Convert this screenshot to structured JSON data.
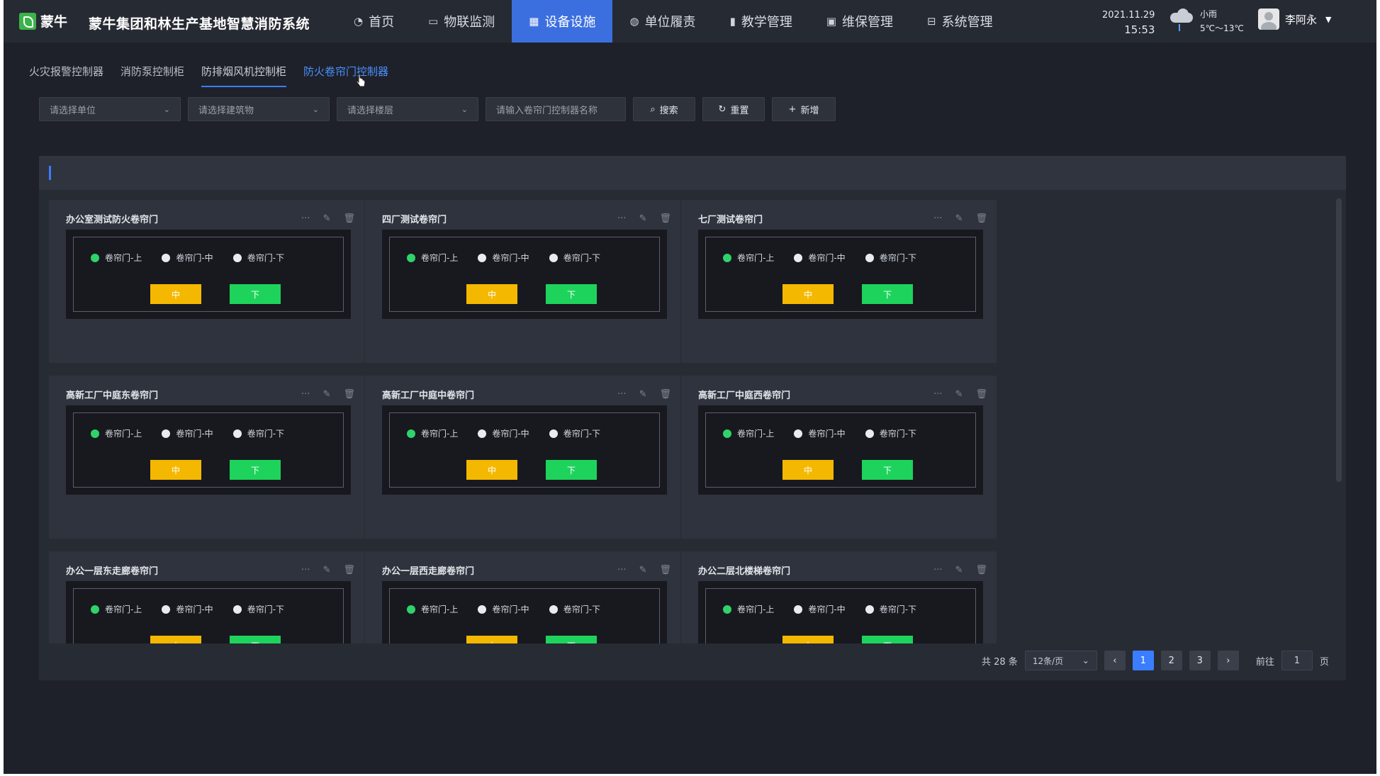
{
  "brand": {
    "logo_text": "蒙牛",
    "system_title": "蒙牛集团和林生产基地智慧消防系统"
  },
  "nav": [
    {
      "label": "首页",
      "icon": "dashboard-icon",
      "glyph": "◔"
    },
    {
      "label": "物联监测",
      "icon": "monitor-icon",
      "glyph": "▭"
    },
    {
      "label": "设备设施",
      "icon": "equipment-icon",
      "glyph": "▦"
    },
    {
      "label": "单位履责",
      "icon": "globe-icon",
      "glyph": "◍"
    },
    {
      "label": "教学管理",
      "icon": "book-icon",
      "glyph": "▮"
    },
    {
      "label": "维保管理",
      "icon": "maintenance-icon",
      "glyph": "▣"
    },
    {
      "label": "系统管理",
      "icon": "briefcase-icon",
      "glyph": "⊟"
    }
  ],
  "nav_active_index": 2,
  "header": {
    "date": "2021.11.29",
    "time": "15:53",
    "weather": "小雨",
    "temperature": "5℃～13℃",
    "user_name": "李阿永"
  },
  "subtabs": [
    "火灾报警控制器",
    "消防泵控制柜",
    "防排烟风机控制柜",
    "防火卷帘门控制器"
  ],
  "subtab_active_index": 3,
  "filters": {
    "unit_placeholder": "请选择单位",
    "building_placeholder": "请选择建筑物",
    "floor_placeholder": "请选择楼层",
    "name_placeholder": "请输入卷帘门控制器名称",
    "search_label": "搜索",
    "reset_label": "重置",
    "add_label": "新增"
  },
  "card_labels": {
    "radio_up": "卷帘门-上",
    "radio_mid": "卷帘门-中",
    "radio_down": "卷帘门-下",
    "btn_mid": "中",
    "btn_down": "下"
  },
  "cards": [
    {
      "title": "办公室测试防火卷帘门"
    },
    {
      "title": "四厂测试卷帘门"
    },
    {
      "title": "七厂测试卷帘门"
    },
    {
      "title": "高新工厂中庭东卷帘门"
    },
    {
      "title": "高新工厂中庭中卷帘门"
    },
    {
      "title": "高新工厂中庭西卷帘门"
    },
    {
      "title": "办公一层东走廊卷帘门"
    },
    {
      "title": "办公一层西走廊卷帘门"
    },
    {
      "title": "办公二层北楼梯卷帘门"
    }
  ],
  "pagination": {
    "total_text": "共 28 条",
    "page_size": "12条/页",
    "pages": [
      "1",
      "2",
      "3"
    ],
    "current_page_index": 0,
    "goto_label": "前往",
    "goto_value": "1",
    "page_unit": "页"
  },
  "colors": {
    "accent": "#3b7dff",
    "nav_active": "#3b6fe0",
    "status_on": "#2fd36a",
    "btn_mid": "#f5b800",
    "btn_down": "#1ed35b"
  }
}
